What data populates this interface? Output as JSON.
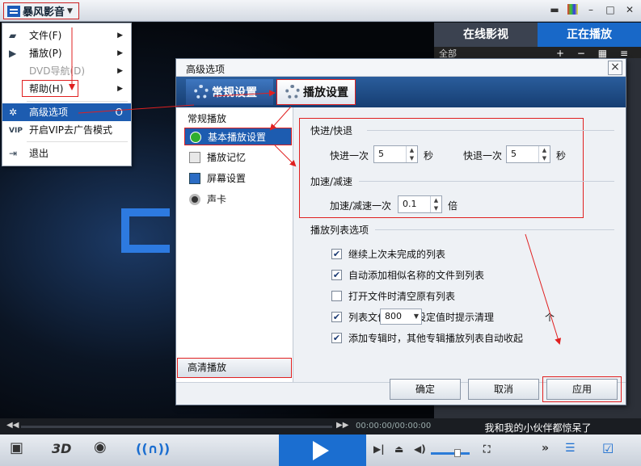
{
  "app": {
    "name": "暴风影音",
    "right_tabs": {
      "online": "在线影视",
      "playing": "正在播放"
    },
    "playlist_toolbar": "全部",
    "time": "00:00:00/00:00:00",
    "slogan": "我和我的小伙伴都惊呆了",
    "control_3d": "3D"
  },
  "menu": {
    "items": [
      {
        "label": "文件(F)"
      },
      {
        "label": "播放(P)"
      },
      {
        "label": "DVD导航(D)"
      },
      {
        "label": "帮助(H)"
      },
      {
        "label": "高级选项",
        "shortcut": "O"
      },
      {
        "label": "开启VIP去广告模式",
        "icon_text": "VIP"
      },
      {
        "label": "退出"
      }
    ]
  },
  "dialog": {
    "title": "高级选项",
    "close": "×",
    "tabs": {
      "general": "常规设置",
      "playback": "播放设置"
    },
    "nav": {
      "group_normal": "常规播放",
      "basic": "基本播放设置",
      "memory": "播放记忆",
      "screen": "屏幕设置",
      "sound": "声卡",
      "group_hd": "高清播放"
    },
    "speed": {
      "section_forward": "快进/快退",
      "forward_label": "快进一次",
      "forward_value": "5",
      "forward_unit": "秒",
      "backward_label": "快退一次",
      "backward_value": "5",
      "backward_unit": "秒",
      "section_rate": "加速/减速",
      "rate_label": "加速/减速一次",
      "rate_value": "0.1",
      "rate_unit": "倍"
    },
    "playlist": {
      "section": "播放列表选项",
      "options": [
        {
          "label": "继续上次未完成的列表",
          "checked": "✔"
        },
        {
          "label": "自动添加相似名称的文件到列表",
          "checked": "✔"
        },
        {
          "label": "打开文件时清空原有列表",
          "checked": ""
        },
        {
          "label": "列表文件数超过设定值时提示清理",
          "checked": "✔"
        },
        {
          "label": "添加专辑时，其他专辑播放列表自动收起",
          "checked": "✔"
        }
      ],
      "limit_value": "800",
      "limit_unit": "个"
    },
    "buttons": {
      "ok": "确定",
      "cancel": "取消",
      "apply": "应用"
    }
  }
}
